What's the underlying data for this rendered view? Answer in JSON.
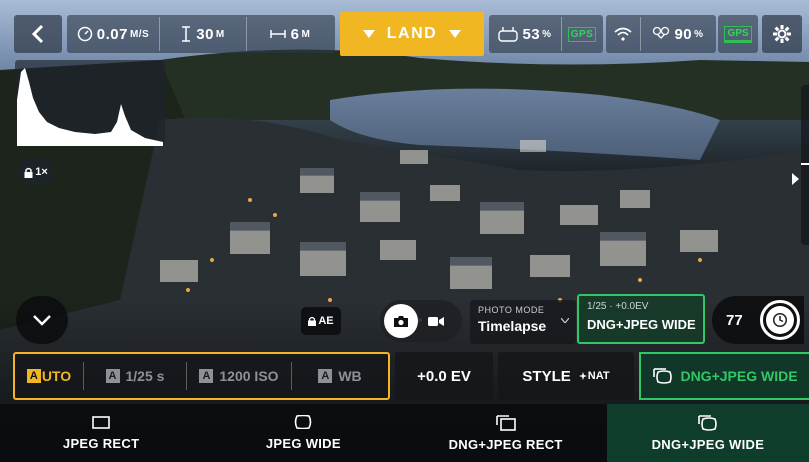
{
  "top_bar": {
    "speed": {
      "value": "0.07",
      "unit": "M/S"
    },
    "altitude": {
      "value": "30",
      "unit": "M"
    },
    "distance": {
      "value": "6",
      "unit": "M"
    },
    "land_label": "LAND",
    "controller_battery": {
      "value": "53",
      "unit": "%"
    },
    "gps_label": "GPS",
    "drone_battery": {
      "value": "90",
      "unit": "%"
    },
    "gps_strong_label": "GPS",
    "icons": [
      "back-icon",
      "speedometer-icon",
      "altitude-icon",
      "distance-icon",
      "chevron-down-icon",
      "controller-icon",
      "wifi-icon",
      "drone-battery-icon",
      "gear-icon"
    ]
  },
  "overlay": {
    "zoom_label": "1×",
    "ae_lock_label": "AE",
    "timer_value": "77",
    "photo_mode_heading": "PHOTO MODE",
    "photo_mode_value": "Timelapse",
    "format_info": "1/25 · +0.0EV",
    "format_value": "DNG+JPEG WIDE"
  },
  "settings_bar": {
    "auto_badge": "A",
    "auto_label": "UTO",
    "shutter_badge": "A",
    "shutter_label": "1/25 s",
    "iso_badge": "A",
    "iso_label": "1200 ISO",
    "wb_badge": "A",
    "wb_label": "WB",
    "ev_label": "+0.0 EV",
    "style_label": "STYLE",
    "style_badge": "NAT",
    "format_label": "DNG+JPEG WIDE"
  },
  "format_options": [
    {
      "label": "JPEG RECT",
      "icon": "rect-frame-icon"
    },
    {
      "label": "JPEG WIDE",
      "icon": "wide-frame-icon"
    },
    {
      "label": "DNG+JPEG RECT",
      "icon": "dng-rect-icon"
    },
    {
      "label": "DNG+JPEG WIDE",
      "icon": "dng-wide-icon",
      "selected": true
    }
  ],
  "colors": {
    "accent_yellow": "#f0b723",
    "accent_green": "#32c766",
    "selected_bg": "#0e3d2b"
  }
}
